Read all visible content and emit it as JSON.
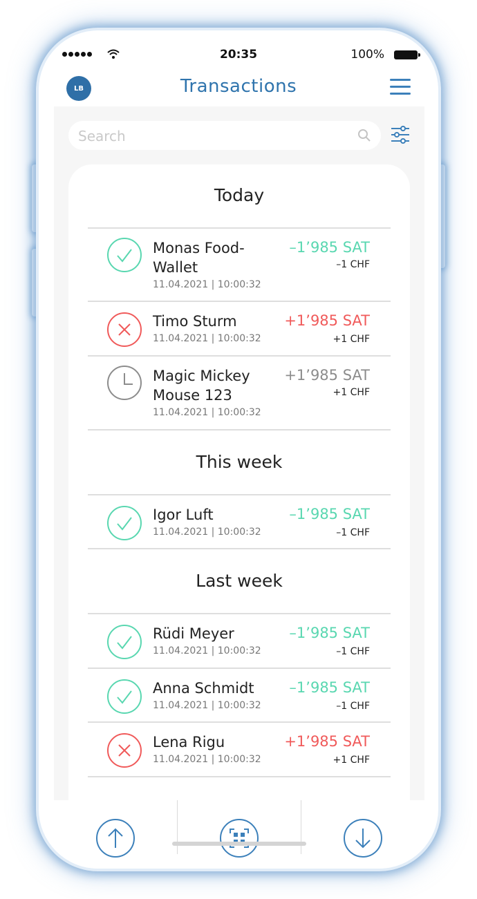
{
  "status_bar": {
    "time": "20:35",
    "battery": "100%"
  },
  "header": {
    "avatar_initials": "LB",
    "title": "Transactions"
  },
  "search": {
    "placeholder": "Search"
  },
  "sections": [
    {
      "title": "Today",
      "transactions": [
        {
          "name_line1": "Monas Food-",
          "name_line2": "Wallet",
          "date": "11.04.2021 | 10:00:32",
          "amount": "–1’985 SAT",
          "chf": "–1 CHF",
          "status": "success"
        },
        {
          "name_line1": "Timo Sturm",
          "name_line2": "",
          "date": "11.04.2021 | 10:00:32",
          "amount": "+1’985 SAT",
          "chf": "+1 CHF",
          "status": "failed"
        },
        {
          "name_line1": "Magic Mickey",
          "name_line2": "Mouse 123",
          "date": "11.04.2021 | 10:00:32",
          "amount": "+1’985 SAT",
          "chf": "+1 CHF",
          "status": "pending"
        }
      ]
    },
    {
      "title": "This week",
      "transactions": [
        {
          "name_line1": "Igor Luft",
          "name_line2": "",
          "date": "11.04.2021 | 10:00:32",
          "amount": "–1’985 SAT",
          "chf": "–1 CHF",
          "status": "success"
        }
      ]
    },
    {
      "title": "Last week",
      "transactions": [
        {
          "name_line1": "Rüdi Meyer",
          "name_line2": "",
          "date": "11.04.2021 | 10:00:32",
          "amount": "–1’985 SAT",
          "chf": "–1 CHF",
          "status": "success"
        },
        {
          "name_line1": "Anna Schmidt",
          "name_line2": "",
          "date": "11.04.2021 | 10:00:32",
          "amount": "–1’985 SAT",
          "chf": "–1 CHF",
          "status": "success"
        },
        {
          "name_line1": "Lena Rigu",
          "name_line2": "",
          "date": "11.04.2021 | 10:00:32",
          "amount": "+1’985 SAT",
          "chf": "+1 CHF",
          "status": "failed"
        }
      ]
    }
  ],
  "icons": {
    "avatar": "user-avatar",
    "menu": "hamburger-menu-icon",
    "search": "search-icon",
    "filter": "filter-sliders-icon",
    "success": "checkmark-circle-icon",
    "failed": "x-circle-icon",
    "pending": "clock-icon",
    "send": "arrow-up-circle-icon",
    "scan": "qr-scan-icon",
    "receive": "arrow-down-circle-icon"
  },
  "colors": {
    "primary": "#2f74ad",
    "success": "#59d7b0",
    "failed": "#f05a5a",
    "pending": "#8c8c8c",
    "background": "#f6f6f6"
  }
}
